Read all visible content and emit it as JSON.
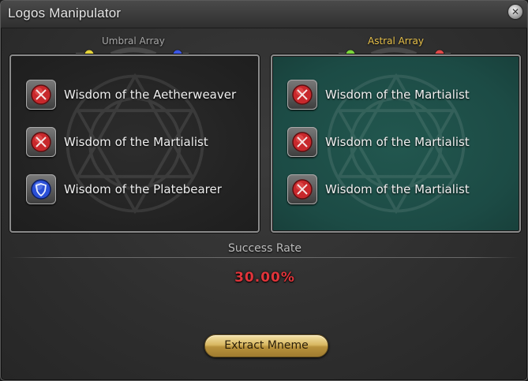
{
  "window": {
    "title": "Logos Manipulator"
  },
  "umbral": {
    "label": "Umbral Array",
    "gems": [
      "yellow",
      "purple",
      "blue"
    ],
    "items": [
      {
        "label": "Wisdom of the Aetherweaver",
        "icon": "red-crossed-swords-icon"
      },
      {
        "label": "Wisdom of the Martialist",
        "icon": "red-crossed-swords-icon"
      },
      {
        "label": "Wisdom of the Platebearer",
        "icon": "blue-shield-icon"
      }
    ]
  },
  "astral": {
    "label": "Astral Array",
    "gems": [
      "green",
      "teal",
      "red"
    ],
    "items": [
      {
        "label": "Wisdom of the Martialist",
        "icon": "red-crossed-swords-icon"
      },
      {
        "label": "Wisdom of the Martialist",
        "icon": "red-crossed-swords-icon"
      },
      {
        "label": "Wisdom of the Martialist",
        "icon": "red-crossed-swords-icon"
      }
    ]
  },
  "success": {
    "label": "Success Rate",
    "value": "30.00%"
  },
  "actions": {
    "extract_label": "Extract Mneme"
  },
  "colors": {
    "accent_gold": "#e8c14a",
    "success_red": "#e0343a",
    "astral_panel": "#1c4b45"
  }
}
